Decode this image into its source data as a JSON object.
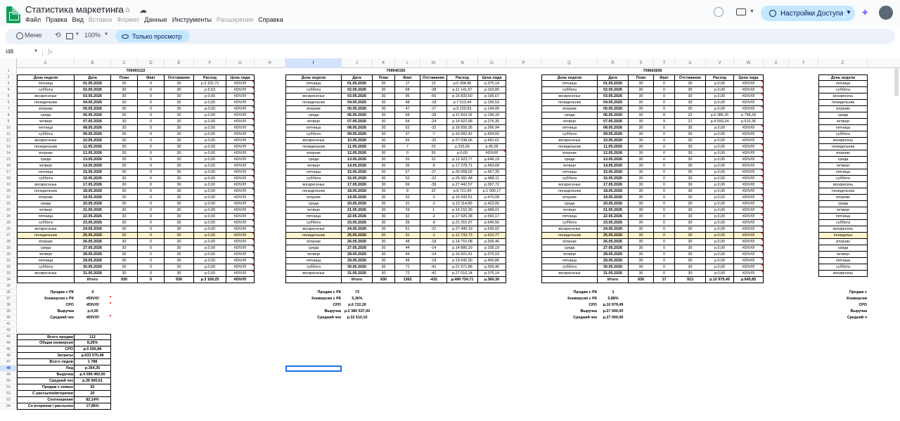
{
  "app": {
    "title": "Статистика маркетинга",
    "menus": [
      {
        "label": "Файл",
        "disabled": false
      },
      {
        "label": "Правка",
        "disabled": false
      },
      {
        "label": "Вид",
        "disabled": false
      },
      {
        "label": "Вставка",
        "disabled": true
      },
      {
        "label": "Формат",
        "disabled": true
      },
      {
        "label": "Данные",
        "disabled": false
      },
      {
        "label": "Инструменты",
        "disabled": false
      },
      {
        "label": "Расширения",
        "disabled": true
      },
      {
        "label": "Справка",
        "disabled": false
      }
    ],
    "share_label": "Настройки Доступа"
  },
  "toolbar": {
    "menu_label": "Меню",
    "zoom": "100%",
    "view_mode": "Только просмотр"
  },
  "formula_bar": {
    "cell_ref": "I48",
    "fx": "fx",
    "value": ""
  },
  "columns": [
    "A",
    "B",
    "C",
    "D",
    "E",
    "F",
    "G",
    "H",
    "I",
    "J",
    "K",
    "L",
    "M",
    "N",
    "O",
    "P",
    "Q",
    "R",
    "S",
    "T",
    "U",
    "V",
    "W",
    "X",
    "Y",
    "Z"
  ],
  "selected_column": "I",
  "selected_row": 48,
  "highlight_row": 27,
  "row_numbers": [
    1,
    2,
    3,
    4,
    5,
    6,
    7,
    8,
    9,
    10,
    11,
    12,
    13,
    14,
    15,
    16,
    17,
    18,
    19,
    20,
    21,
    22,
    23,
    24,
    25,
    26,
    27,
    28,
    29,
    30,
    31,
    32,
    33,
    34,
    35,
    36,
    37,
    38,
    39,
    40,
    41,
    42,
    43,
    44,
    45,
    46,
    47,
    48,
    49,
    50,
    51,
    52,
    53,
    54
  ],
  "table_headers": [
    "День недели",
    "Дата",
    "План",
    "Факт",
    "Отставание",
    "Расход",
    "Цена лида"
  ],
  "blocks": [
    {
      "id": "709493122",
      "rows": [
        [
          "пятница",
          "01.05.2026",
          "30",
          "0",
          "30",
          "р.3 162,72",
          "#DIV/0!"
        ],
        [
          "суббота",
          "02.05.2026",
          "30",
          "0",
          "30",
          "р.6,53",
          "#DIV/0!"
        ],
        [
          "воскресенье",
          "03.05.2026",
          "30",
          "0",
          "30",
          "р.0,00",
          "#DIV/0!"
        ],
        [
          "понедельник",
          "04.05.2026",
          "30",
          "0",
          "30",
          "р.0,00",
          "#DIV/0!"
        ],
        [
          "вторник",
          "05.05.2026",
          "30",
          "0",
          "30",
          "р.0,00",
          "#DIV/0!"
        ],
        [
          "среда",
          "06.05.2026",
          "30",
          "0",
          "30",
          "р.0,00",
          "#DIV/0!"
        ],
        [
          "четверг",
          "07.05.2026",
          "30",
          "0",
          "30",
          "р.0,00",
          "#DIV/0!"
        ],
        [
          "пятница",
          "08.05.2026",
          "30",
          "0",
          "30",
          "р.0,00",
          "#DIV/0!"
        ],
        [
          "суббота",
          "09.05.2026",
          "30",
          "0",
          "30",
          "р.0,00",
          "#DIV/0!"
        ],
        [
          "воскресенье",
          "10.05.2026",
          "30",
          "0",
          "30",
          "р.0,00",
          "#DIV/0!"
        ],
        [
          "понедельник",
          "11.05.2026",
          "30",
          "0",
          "30",
          "р.0,00",
          "#DIV/0!"
        ],
        [
          "вторник",
          "12.05.2026",
          "30",
          "0",
          "30",
          "р.0,00",
          "#DIV/0!"
        ],
        [
          "среда",
          "13.05.2026",
          "30",
          "0",
          "30",
          "р.0,00",
          "#DIV/0!"
        ],
        [
          "четверг",
          "14.05.2026",
          "30",
          "0",
          "30",
          "р.0,00",
          "#DIV/0!"
        ],
        [
          "пятница",
          "15.05.2026",
          "30",
          "0",
          "30",
          "р.0,00",
          "#DIV/0!"
        ],
        [
          "суббота",
          "16.05.2026",
          "30",
          "0",
          "30",
          "р.0,00",
          "#DIV/0!"
        ],
        [
          "воскресенье",
          "17.05.2026",
          "30",
          "0",
          "30",
          "р.0,00",
          "#DIV/0!"
        ],
        [
          "понедельник",
          "18.05.2026",
          "30",
          "0",
          "30",
          "р.0,00",
          "#DIV/0!"
        ],
        [
          "вторник",
          "19.05.2026",
          "30",
          "0",
          "30",
          "р.0,00",
          "#DIV/0!"
        ],
        [
          "среда",
          "20.05.2026",
          "30",
          "0",
          "30",
          "р.0,00",
          "#DIV/0!"
        ],
        [
          "четверг",
          "21.05.2026",
          "30",
          "0",
          "30",
          "р.0,00",
          "#DIV/0!"
        ],
        [
          "пятница",
          "22.05.2026",
          "30",
          "0",
          "30",
          "р.0,00",
          "#DIV/0!"
        ],
        [
          "суббота",
          "23.05.2026",
          "30",
          "0",
          "30",
          "р.0,00",
          "#DIV/0!"
        ],
        [
          "воскресенье",
          "24.05.2026",
          "30",
          "0",
          "30",
          "р.0,00",
          "#DIV/0!"
        ],
        [
          "понедельник",
          "25.05.2026",
          "30",
          "0",
          "30",
          "р.0,00",
          "#DIV/0!"
        ],
        [
          "вторник",
          "26.05.2026",
          "30",
          "0",
          "30",
          "р.0,00",
          "#DIV/0!"
        ],
        [
          "среда",
          "27.05.2026",
          "30",
          "0",
          "30",
          "р.0,00",
          "#DIV/0!"
        ],
        [
          "четверг",
          "28.05.2026",
          "30",
          "0",
          "30",
          "р.0,00",
          "#DIV/0!"
        ],
        [
          "пятница",
          "29.05.2026",
          "30",
          "0",
          "30",
          "р.0,00",
          "#DIV/0!"
        ],
        [
          "суббота",
          "30.05.2026",
          "30",
          "0",
          "30",
          "р.0,00",
          "#DIV/0!"
        ],
        [
          "воскресенье",
          "31.05.2026",
          "30",
          "0",
          "30",
          "р.0,00",
          "#DIV/0!"
        ]
      ],
      "total": [
        "",
        "Итого",
        "930",
        "0",
        "930",
        "р.3 169,25",
        "#DIV/0!"
      ],
      "summary": [
        [
          "Продаж с РК",
          "0"
        ],
        [
          "Конверсия с РК",
          "#DIV/0!"
        ],
        [
          "CPO",
          "#DIV/0!"
        ],
        [
          "Выручка",
          "р.0,00"
        ],
        [
          "Средний чек",
          "#DIV/0!"
        ]
      ]
    },
    {
      "id": "709545192",
      "rows": [
        [
          "пятница",
          "01.05.2026",
          "30",
          "17",
          "13",
          "р.6 394,45",
          "р.376,14"
        ],
        [
          "суббота",
          "02.05.2026",
          "30",
          "68",
          "-38",
          "р.11 141,57",
          "р.163,85"
        ],
        [
          "воскресенье",
          "03.05.2026",
          "30",
          "95",
          "-65",
          "р.15 833,60",
          "р.166,67"
        ],
        [
          "понедельник",
          "04.05.2026",
          "30",
          "48",
          "-18",
          "р.7 513,44",
          "р.156,53"
        ],
        [
          "вторник",
          "05.05.2026",
          "30",
          "47",
          "-17",
          "р.9 120,93",
          "р.194,06"
        ],
        [
          "среда",
          "06.05.2026",
          "30",
          "58",
          "-28",
          "р.11 503,16",
          "р.198,33"
        ],
        [
          "четверг",
          "07.05.2026",
          "30",
          "54",
          "-24",
          "р.14 922,68",
          "р.276,35"
        ],
        [
          "пятница",
          "08.05.2026",
          "30",
          "62",
          "-32",
          "р.16 550,35",
          "р.266,94"
        ],
        [
          "суббота",
          "09.05.2026",
          "30",
          "37",
          "-7",
          "р.16 082,42",
          "р.434,66"
        ],
        [
          "воскресенье",
          "10.05.2026",
          "30",
          "55",
          "-25",
          "р.27 038,66",
          "р.491,61"
        ],
        [
          "понедельник",
          "11.05.2026",
          "30",
          "7",
          "23",
          "р.315,65",
          "р.45,09"
        ],
        [
          "вторник",
          "12.05.2026",
          "30",
          "0",
          "30",
          "р.0,00",
          "#DIV/0!"
        ],
        [
          "среда",
          "13.05.2026",
          "30",
          "20",
          "10",
          "р.12 923,77",
          "р.646,19"
        ],
        [
          "четверг",
          "14.05.2026",
          "30",
          "35",
          "-5",
          "р.17 278,71",
          "р.493,68"
        ],
        [
          "пятница",
          "15.05.2026",
          "30",
          "57",
          "-27",
          "р.26 068,92",
          "р.457,35"
        ],
        [
          "суббота",
          "16.05.2026",
          "30",
          "52",
          "-22",
          "р.25 381,48",
          "р.488,11"
        ],
        [
          "воскресенье",
          "17.05.2026",
          "30",
          "69",
          "-39",
          "р.27 442,57",
          "р.397,72"
        ],
        [
          "понедельник",
          "18.05.2026",
          "30",
          "8",
          "22",
          "р.8 721,34",
          "р.1 090,17"
        ],
        [
          "вторник",
          "19.05.2026",
          "30",
          "32",
          "-2",
          "р.15 042,51",
          "р.470,08"
        ],
        [
          "среда",
          "20.05.2026",
          "30",
          "31",
          "-1",
          "р.13 114,80",
          "р.423,06"
        ],
        [
          "четверг",
          "21.05.2026",
          "30",
          "29",
          "1",
          "р.14 152,35",
          "р.488,01"
        ],
        [
          "пятница",
          "22.05.2026",
          "30",
          "32",
          "-2",
          "р.17 925,38",
          "р.560,17"
        ],
        [
          "суббота",
          "23.05.2026",
          "30",
          "39",
          "-9",
          "р.21 315,97",
          "р.546,56"
        ],
        [
          "воскресенье",
          "24.05.2026",
          "30",
          "51",
          "-21",
          "р.27 490,19",
          "р.539,02"
        ],
        [
          "понедельник",
          "25.05.2026",
          "30",
          "31",
          "-1",
          "р.12 733,73",
          "р.410,77"
        ],
        [
          "вторник",
          "26.05.2026",
          "30",
          "48",
          "-18",
          "р.14 710,08",
          "р.306,46"
        ],
        [
          "среда",
          "27.05.2026",
          "30",
          "44",
          "-14",
          "р.14 880,29",
          "р.338,19"
        ],
        [
          "четверг",
          "28.05.2026",
          "30",
          "44",
          "-14",
          "р.16 501,41",
          "р.375,03"
        ],
        [
          "пятница",
          "29.05.2026",
          "30",
          "49",
          "-19",
          "р.19 642,30",
          "р.400,86"
        ],
        [
          "суббота",
          "30.05.2026",
          "30",
          "71",
          "-41",
          "р.21 971,86",
          "р.309,46"
        ],
        [
          "воскресенье",
          "31.05.2026",
          "30",
          "72",
          "-42",
          "р.27 010,14",
          "р.375,14"
        ]
      ],
      "total": [
        "",
        "Итого",
        "930",
        "1362",
        "-432",
        "р.490 724,71",
        "р.360,30"
      ],
      "summary": [
        [
          "Продаж с РК",
          "73"
        ],
        [
          "Конверсия с РК",
          "5,36%"
        ],
        [
          "CPO",
          "р.6 722,26"
        ],
        [
          "Выручка",
          "р.2 380 537,00"
        ],
        [
          "Средний чек",
          "р.32 610,10"
        ]
      ]
    },
    {
      "id": "709663656",
      "rows": [
        [
          "пятница",
          "01.05.2026",
          "30",
          "0",
          "30",
          "р.0,00",
          "#DIV/0!"
        ],
        [
          "суббота",
          "02.05.2026",
          "30",
          "0",
          "30",
          "р.0,00",
          "#DIV/0!"
        ],
        [
          "воскресенье",
          "03.05.2026",
          "30",
          "0",
          "30",
          "р.0,00",
          "#DIV/0!"
        ],
        [
          "понедельник",
          "04.05.2026",
          "30",
          "0",
          "30",
          "р.0,00",
          "#DIV/0!"
        ],
        [
          "вторник",
          "05.05.2026",
          "30",
          "0",
          "30",
          "р.0,00",
          "#DIV/0!"
        ],
        [
          "среда",
          "06.05.2026",
          "30",
          "8",
          "22",
          "р.6 386,25",
          "р.798,28"
        ],
        [
          "четверг",
          "07.05.2026",
          "30",
          "9",
          "21",
          "р.4 593,24",
          "р.510,36"
        ],
        [
          "пятница",
          "08.05.2026",
          "30",
          "0",
          "30",
          "р.0,00",
          "#DIV/0!"
        ],
        [
          "суббота",
          "09.05.2026",
          "30",
          "0",
          "30",
          "р.0,00",
          "#DIV/0!"
        ],
        [
          "воскресенье",
          "10.05.2026",
          "30",
          "0",
          "30",
          "р.0,00",
          "#DIV/0!"
        ],
        [
          "понедельник",
          "11.05.2026",
          "30",
          "0",
          "30",
          "р.0,00",
          "#DIV/0!"
        ],
        [
          "вторник",
          "12.05.2026",
          "30",
          "0",
          "30",
          "р.0,00",
          "#DIV/0!"
        ],
        [
          "среда",
          "13.05.2026",
          "30",
          "0",
          "30",
          "р.0,00",
          "#DIV/0!"
        ],
        [
          "четверг",
          "14.05.2026",
          "30",
          "0",
          "30",
          "р.0,00",
          "#DIV/0!"
        ],
        [
          "пятница",
          "15.05.2026",
          "30",
          "0",
          "30",
          "р.0,00",
          "#DIV/0!"
        ],
        [
          "суббота",
          "16.05.2026",
          "30",
          "0",
          "30",
          "р.0,00",
          "#DIV/0!"
        ],
        [
          "воскресенье",
          "17.05.2026",
          "30",
          "0",
          "30",
          "р.0,00",
          "#DIV/0!"
        ],
        [
          "понедельник",
          "18.05.2026",
          "30",
          "0",
          "30",
          "р.0,00",
          "#DIV/0!"
        ],
        [
          "вторник",
          "19.05.2026",
          "30",
          "0",
          "30",
          "р.0,00",
          "#DIV/0!"
        ],
        [
          "среда",
          "20.05.2026",
          "30",
          "0",
          "30",
          "р.0,00",
          "#DIV/0!"
        ],
        [
          "четверг",
          "21.05.2026",
          "30",
          "0",
          "30",
          "р.0,00",
          "#DIV/0!"
        ],
        [
          "пятница",
          "22.05.2026",
          "30",
          "0",
          "30",
          "р.0,00",
          "#DIV/0!"
        ],
        [
          "суббота",
          "23.05.2026",
          "30",
          "0",
          "30",
          "р.0,00",
          "#DIV/0!"
        ],
        [
          "воскресенье",
          "24.05.2026",
          "30",
          "0",
          "30",
          "р.0,00",
          "#DIV/0!"
        ],
        [
          "понедельник",
          "25.05.2026",
          "30",
          "0",
          "30",
          "р.0,00",
          "#DIV/0!"
        ],
        [
          "вторник",
          "26.05.2026",
          "30",
          "0",
          "30",
          "р.0,00",
          "#DIV/0!"
        ],
        [
          "среда",
          "27.05.2026",
          "30",
          "0",
          "30",
          "р.0,00",
          "#DIV/0!"
        ],
        [
          "четверг",
          "28.05.2026",
          "30",
          "0",
          "30",
          "р.0,00",
          "#DIV/0!"
        ],
        [
          "пятница",
          "29.05.2026",
          "30",
          "0",
          "30",
          "р.0,00",
          "#DIV/0!"
        ],
        [
          "суббота",
          "30.05.2026",
          "30",
          "0",
          "30",
          "р.0,00",
          "#DIV/0!"
        ],
        [
          "воскресенье",
          "31.05.2026",
          "30",
          "0",
          "30",
          "р.0,00",
          "#DIV/0!"
        ]
      ],
      "total": [
        "",
        "Итого",
        "930",
        "17",
        "913",
        "р.10 979,49",
        "р.645,85"
      ],
      "summary": [
        [
          "Продаж с РК",
          "1"
        ],
        [
          "Конверсия с РК",
          "5,88%"
        ],
        [
          "CPO",
          "р.10 979,49"
        ],
        [
          "Выручка",
          "р.27 000,00"
        ],
        [
          "Средний чек",
          "р.27 000,00"
        ]
      ]
    }
  ],
  "block4": {
    "header": "День недели",
    "days": [
      "пятница",
      "суббота",
      "воскресень",
      "понедельник",
      "вторник",
      "среда",
      "четверг",
      "пятница",
      "суббота",
      "воскресень",
      "понедельник",
      "вторник",
      "среда",
      "четверг",
      "пятница",
      "суббота",
      "воскресень",
      "понедельник",
      "вторник",
      "среда",
      "четверг",
      "пятница",
      "суббота",
      "воскресень",
      "понедельн",
      "вторник",
      "среда",
      "четверг",
      "пятница",
      "суббота",
      "воскресень"
    ],
    "summary_labels": [
      "Продаж с",
      "Конверсия",
      "CPO",
      "Выручка",
      "Средний ч"
    ]
  },
  "overall": [
    [
      "Всего продаж",
      "112"
    ],
    [
      "Общая конверсия",
      "8,26%"
    ],
    [
      "CPO",
      "р.5 656,88"
    ],
    [
      "Затраты",
      "р.633 570,48"
    ],
    [
      "Всего лидов",
      "1 788"
    ],
    [
      "Лид",
      "р.354,35"
    ],
    [
      "Выручка",
      "р.4 095 460,00"
    ],
    [
      "Средний чек",
      "р.36 566,61"
    ],
    [
      "Продаж с новых",
      "92"
    ],
    [
      "С рассылок/вторички",
      "20"
    ],
    [
      "Соотношение",
      "82,14%"
    ],
    [
      "Со вторички / рассылок",
      "17,86%"
    ]
  ],
  "colors": {
    "highlight_row": "#fff3cd",
    "selection": "#1a73e8",
    "error_tri": "#ea4335",
    "share_bg": "#c2e7ff"
  }
}
